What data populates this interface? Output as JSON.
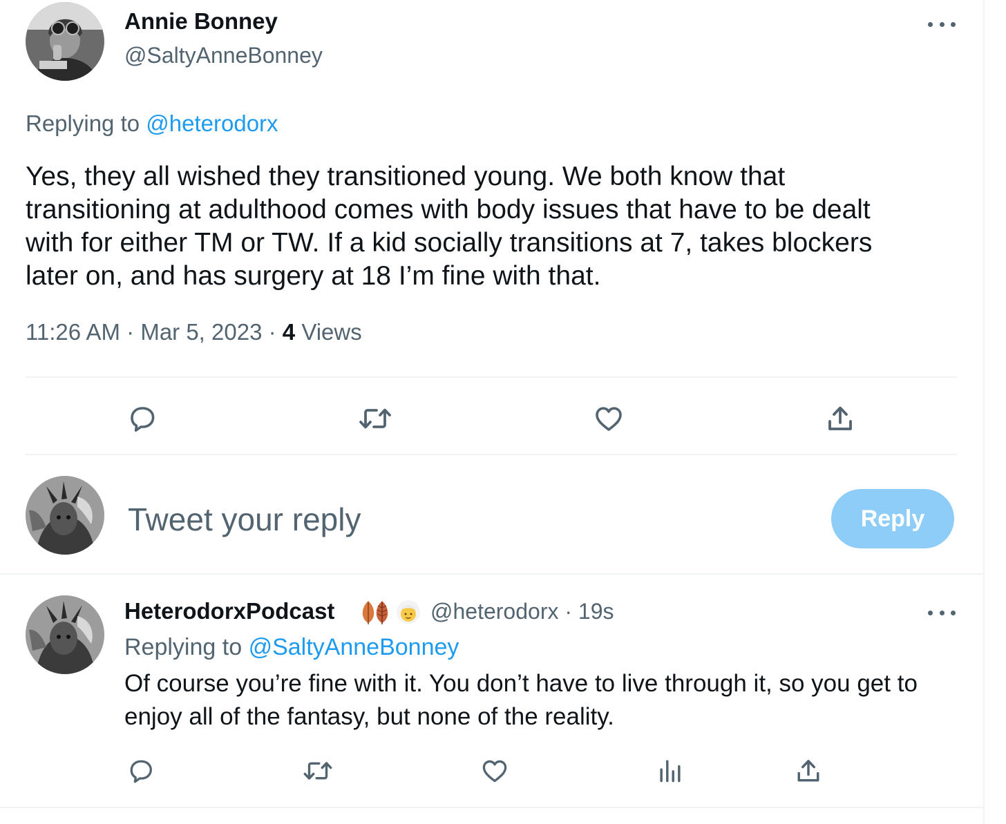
{
  "tweet": {
    "display_name": "Annie Bonney",
    "handle": "@SaltyAnneBonney",
    "replying_prefix": "Replying to",
    "replying_to": "@heterodorx",
    "text": "Yes, they all wished they transitioned young. We both know that\ntransitioning at adulthood comes with body issues that have to be dealt\nwith for either TM or TW.  If a kid socially transitions at 7, takes blockers\nlater on, and has surgery at 18 I’m fine with that.",
    "time": "11:26 AM",
    "date": "Mar 5, 2023",
    "separator": "·",
    "views_count": "4",
    "views_label": "Views",
    "avatar_icon": "avatar-photo-icon",
    "more_icon": "more-icon"
  },
  "actions": {
    "icons": [
      "comment-icon",
      "retweet-icon",
      "like-icon",
      "share-icon"
    ]
  },
  "compose": {
    "placeholder": "Tweet your reply",
    "button_label": "Reply",
    "button_color": "#8ecdf8"
  },
  "reply": {
    "display_name": "HeterodorxPodcast",
    "handle": "@heterodorx",
    "separator": "·",
    "time": "19s",
    "replying_prefix": "Replying to",
    "replying_to": "@SaltyAnneBonney",
    "text": "Of course you’re fine with it. You don’t have to live through it, so you get to enjoy all of the fantasy, but none of the reality.",
    "icons": [
      "comment-icon",
      "retweet-icon",
      "like-icon",
      "analytics-icon",
      "share-icon"
    ],
    "emoji_icons": [
      "leaf-icon",
      "leaf-icon",
      "person-emoji-icon"
    ]
  },
  "colors": {
    "accent": "#1d9bf0",
    "secondary_text": "#536471",
    "primary_text": "#0f1419",
    "divider": "#eff3f4"
  }
}
